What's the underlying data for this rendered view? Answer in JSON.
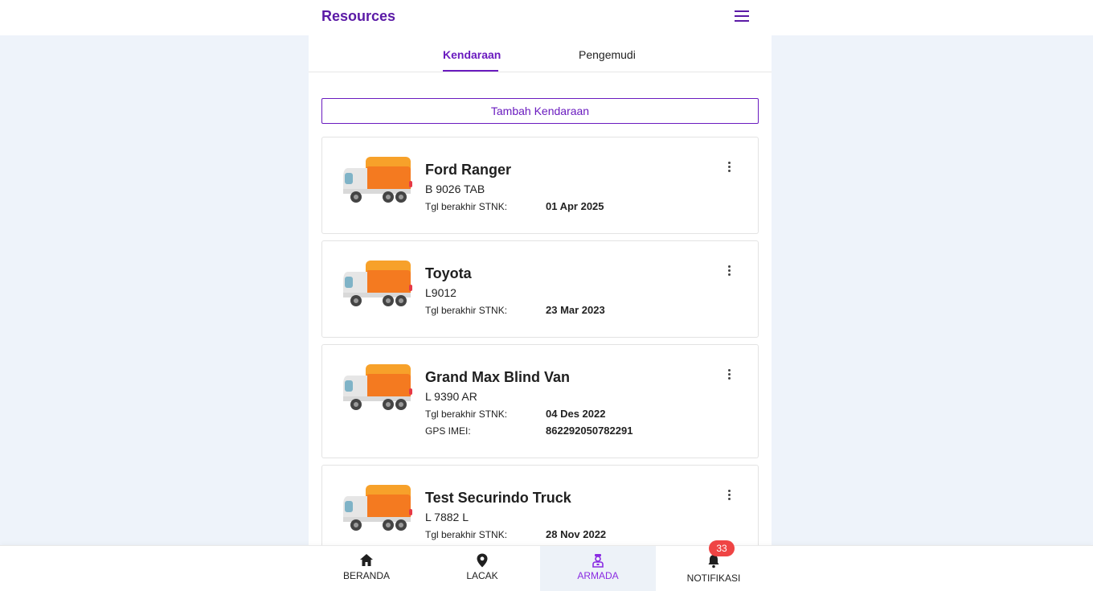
{
  "header": {
    "title": "Resources",
    "menu_icon": "hamburger-menu-icon"
  },
  "tabs": [
    {
      "label": "Kendaraan",
      "active": true
    },
    {
      "label": "Pengemudi",
      "active": false
    }
  ],
  "add_button": {
    "label": "Tambah Kendaraan"
  },
  "vehicles": [
    {
      "name": "Ford Ranger",
      "plate": "B 9026 TAB",
      "stnk_label": "Tgl berakhir STNK:",
      "stnk_date": "01 Apr 2025"
    },
    {
      "name": "Toyota",
      "plate": "L9012",
      "stnk_label": "Tgl berakhir STNK:",
      "stnk_date": "23 Mar 2023"
    },
    {
      "name": "Grand Max Blind Van",
      "plate": "L 9390 AR",
      "stnk_label": "Tgl berakhir STNK:",
      "stnk_date": "04 Des 2022",
      "imei_label": "GPS IMEI:",
      "imei": "862292050782291"
    },
    {
      "name": "Test Securindo Truck",
      "plate": "L 7882 L",
      "stnk_label": "Tgl berakhir STNK:",
      "stnk_date": "28 Nov 2022"
    }
  ],
  "bottom_nav": [
    {
      "label": "BERANDA",
      "icon": "home-icon"
    },
    {
      "label": "LACAK",
      "icon": "location-pin-icon"
    },
    {
      "label": "ARMADA",
      "icon": "fleet-driver-icon",
      "active": true
    },
    {
      "label": "NOTIFIKASI",
      "icon": "bell-icon",
      "badge": "33"
    }
  ],
  "colors": {
    "accent": "#6a1bbf",
    "page_bg": "#eef3fa",
    "badge": "#ef4444",
    "truck_orange": "#f47a20"
  }
}
